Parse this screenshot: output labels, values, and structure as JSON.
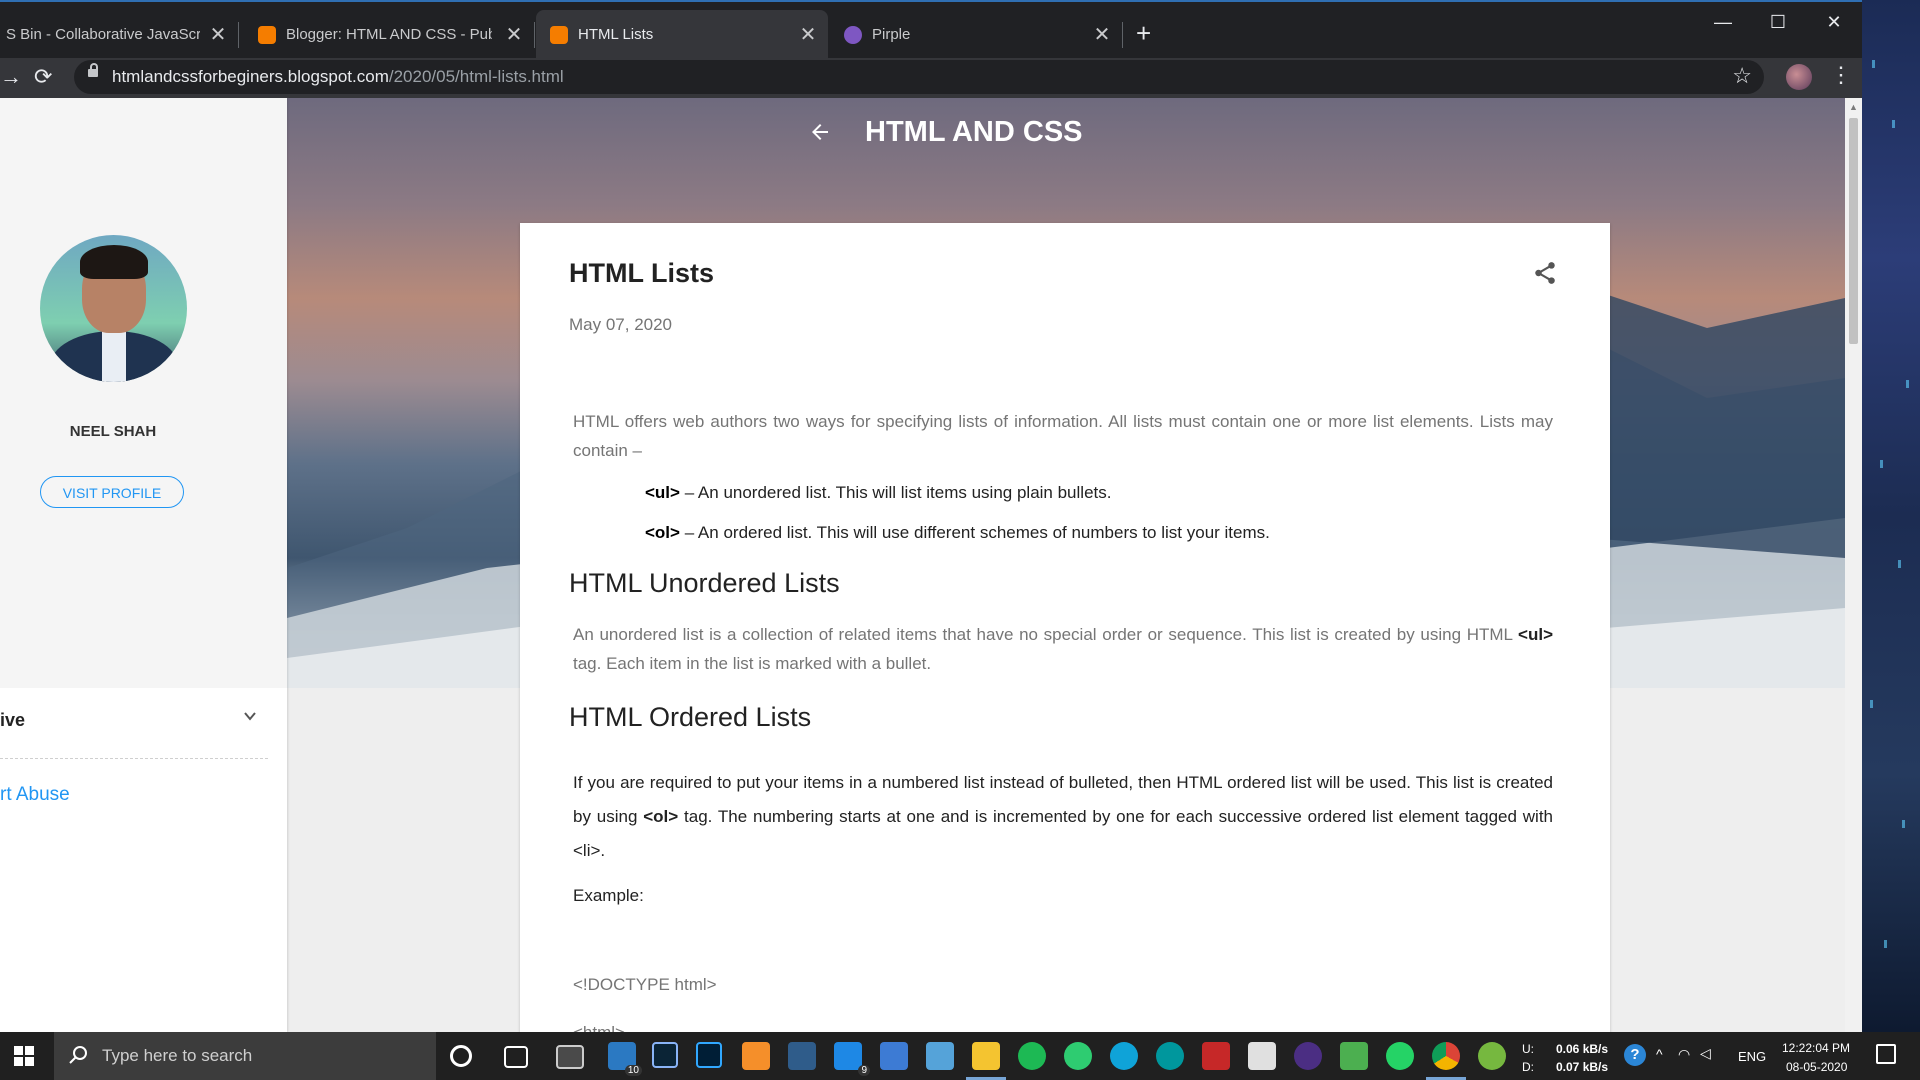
{
  "browser": {
    "tabs": [
      {
        "title": "S Bin - Collaborative JavaScript Debugging",
        "favicon_color": "#e0e0e0",
        "active": false
      },
      {
        "title": "Blogger: HTML AND CSS - Published",
        "favicon_color": "#f57d00",
        "active": false
      },
      {
        "title": "HTML Lists",
        "favicon_color": "#f57d00",
        "active": true
      },
      {
        "title": "Pirple",
        "favicon_color": "#7e57c2",
        "active": false
      }
    ],
    "new_tab_label": "+",
    "url_host": "htmlandcssforbeginers.blogspot.com",
    "url_path": "/2020/05/html-lists.html"
  },
  "sidebar": {
    "profile_name": "NEEL SHAH",
    "visit_profile_label": "VISIT PROFILE",
    "archive_label": "ive",
    "report_abuse_label": "rt Abuse"
  },
  "blog": {
    "title": "HTML AND CSS"
  },
  "post": {
    "title": "HTML Lists",
    "date": "May 07, 2020",
    "intro": "HTML offers web authors two ways for specifying lists of information. All lists must contain one or more list elements. Lists may contain –",
    "list_items": [
      {
        "tag": "<ul>",
        "text": " – An unordered list. This will list items using plain bullets."
      },
      {
        "tag": "<ol>",
        "text": " – An ordered list. This will use different schemes of numbers to list your items."
      }
    ],
    "h2_unordered": "HTML Unordered Lists",
    "unordered_p1": "An unordered list is a collection of related items that have no special order or sequence. This list is created by using HTML ",
    "unordered_tag": "<ul>",
    "unordered_p2": " tag. Each item in the list is marked with a bullet.",
    "h2_ordered": "HTML Ordered Lists",
    "ordered_p1": "If you are required to put your items in a numbered list instead of bulleted, then HTML ordered list will be used. This list is created by using ",
    "ordered_tag": "<ol>",
    "ordered_p2": " tag. The numbering starts at one and is incremented by one for each successive ordered list element tagged with <li>.",
    "example_label": "Example:",
    "code_line1": "<!DOCTYPE html>",
    "code_line2": "<html>"
  },
  "taskbar": {
    "search_placeholder": "Type here to search",
    "badge_mail": "9",
    "badge_store": "10",
    "net_up_label": "U:",
    "net_down_label": "D:",
    "net_up": "0.06 kB/s",
    "net_down": "0.07 kB/s",
    "language": "ENG",
    "time": "12:22:04 PM",
    "date": "08-05-2020"
  }
}
